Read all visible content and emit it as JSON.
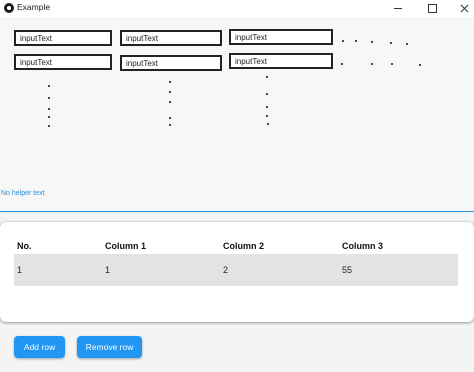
{
  "window": {
    "title": "Example"
  },
  "inputs": [
    {
      "id": "r1c1",
      "value": "inputText"
    },
    {
      "id": "r1c2",
      "value": "inputText"
    },
    {
      "id": "r1c3",
      "value": "inputText"
    },
    {
      "id": "r2c1",
      "value": "inputText"
    },
    {
      "id": "r2c2",
      "value": "inputText"
    },
    {
      "id": "r2c3",
      "value": "inputText"
    }
  ],
  "helper_text": "No helper text",
  "table": {
    "headers": [
      "No.",
      "Column 1",
      "Column 2",
      "Column 3"
    ],
    "rows": [
      [
        "1",
        "1",
        "2",
        "55"
      ]
    ]
  },
  "buttons": {
    "add_row": "Add row",
    "remove_row": "Remove row"
  },
  "colors": {
    "accent": "#2196f3",
    "helper": "#2a8fd8",
    "row_bg": "#e3e3e3"
  }
}
